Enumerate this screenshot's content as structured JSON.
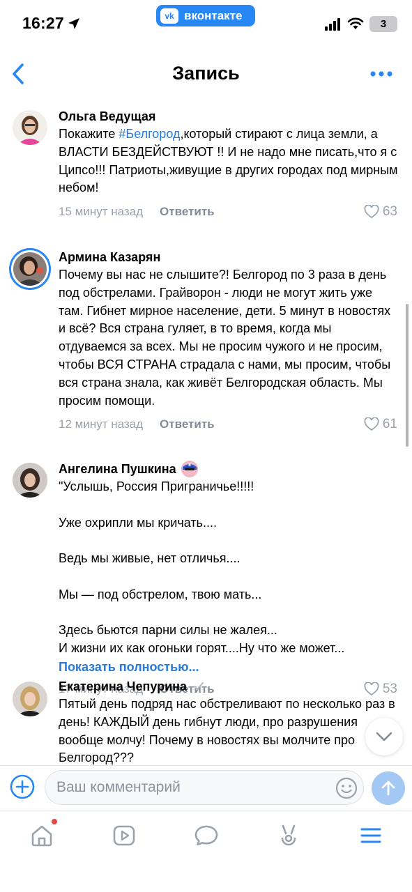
{
  "status_bar": {
    "time": "16:27",
    "app_pill": "вконтакте",
    "app_logo": "vk",
    "battery": "3"
  },
  "nav": {
    "title": "Запись"
  },
  "comments": [
    {
      "author": "Ольга Ведущая",
      "text_before": "Покажите ",
      "hashtag": "#Белгород",
      "text_after": ",который стирают с лица земли, а ВЛАСТИ БЕЗДЕЙСТВУЮТ !! И не надо мне писать,что я с Ципсо!!! Патриоты,живущие в других городах под мирным небом!",
      "time": "15 минут назад",
      "reply": "Ответить",
      "likes": "63"
    },
    {
      "author": "Армина Казарян",
      "text": "Почему вы нас не слышите?! Белгород по 3 раза в день под обстрелами. Грайворон - люди не могут жить уже там. Гибнет мирное население, дети. 5 минут в новостях и всё? Вся страна гуляет, в то время, когда мы отдуваемся за всех. Мы не просим чужого и не просим, чтобы ВСЯ СТРАНА страдала с нами, мы просим, чтобы вся страна знала, как живёт Белгородская область. Мы просим помощи.",
      "time": "12 минут назад",
      "reply": "Ответить",
      "likes": "61"
    },
    {
      "author": "Ангелина Пушкина",
      "lines": [
        "\"Услышь, Россия Приграничье!!!!!",
        "Уже охрипли мы кричать....",
        "Ведь мы живые, нет отличья....",
        "Мы —  под обстрелом, твою мать...",
        "Здесь бьются парни силы не жалея...",
        "И жизни их как огоньки горят....Ну что же может..."
      ],
      "show_more": "Показать полностью...",
      "time": "17 минут назад",
      "reply": "Ответить",
      "likes": "53"
    },
    {
      "author": "Екатерина Чепурина",
      "text": "Пятый день подряд нас обстреливают по несколько раз в день! КАЖДЫЙ день гибнут люди, про разрушения вообще молчу! Почему в новостях вы молчите про Белгород???"
    }
  ],
  "composer": {
    "placeholder": "Ваш комментарий"
  },
  "tab_bar": {
    "items": [
      "home-icon",
      "video-icon",
      "messages-icon",
      "clips-icon",
      "menu-icon"
    ]
  },
  "colors": {
    "accent": "#2787f5",
    "link": "#2a7ad9",
    "meta": "#99a2ad",
    "send_button": "#a2c8f3"
  }
}
